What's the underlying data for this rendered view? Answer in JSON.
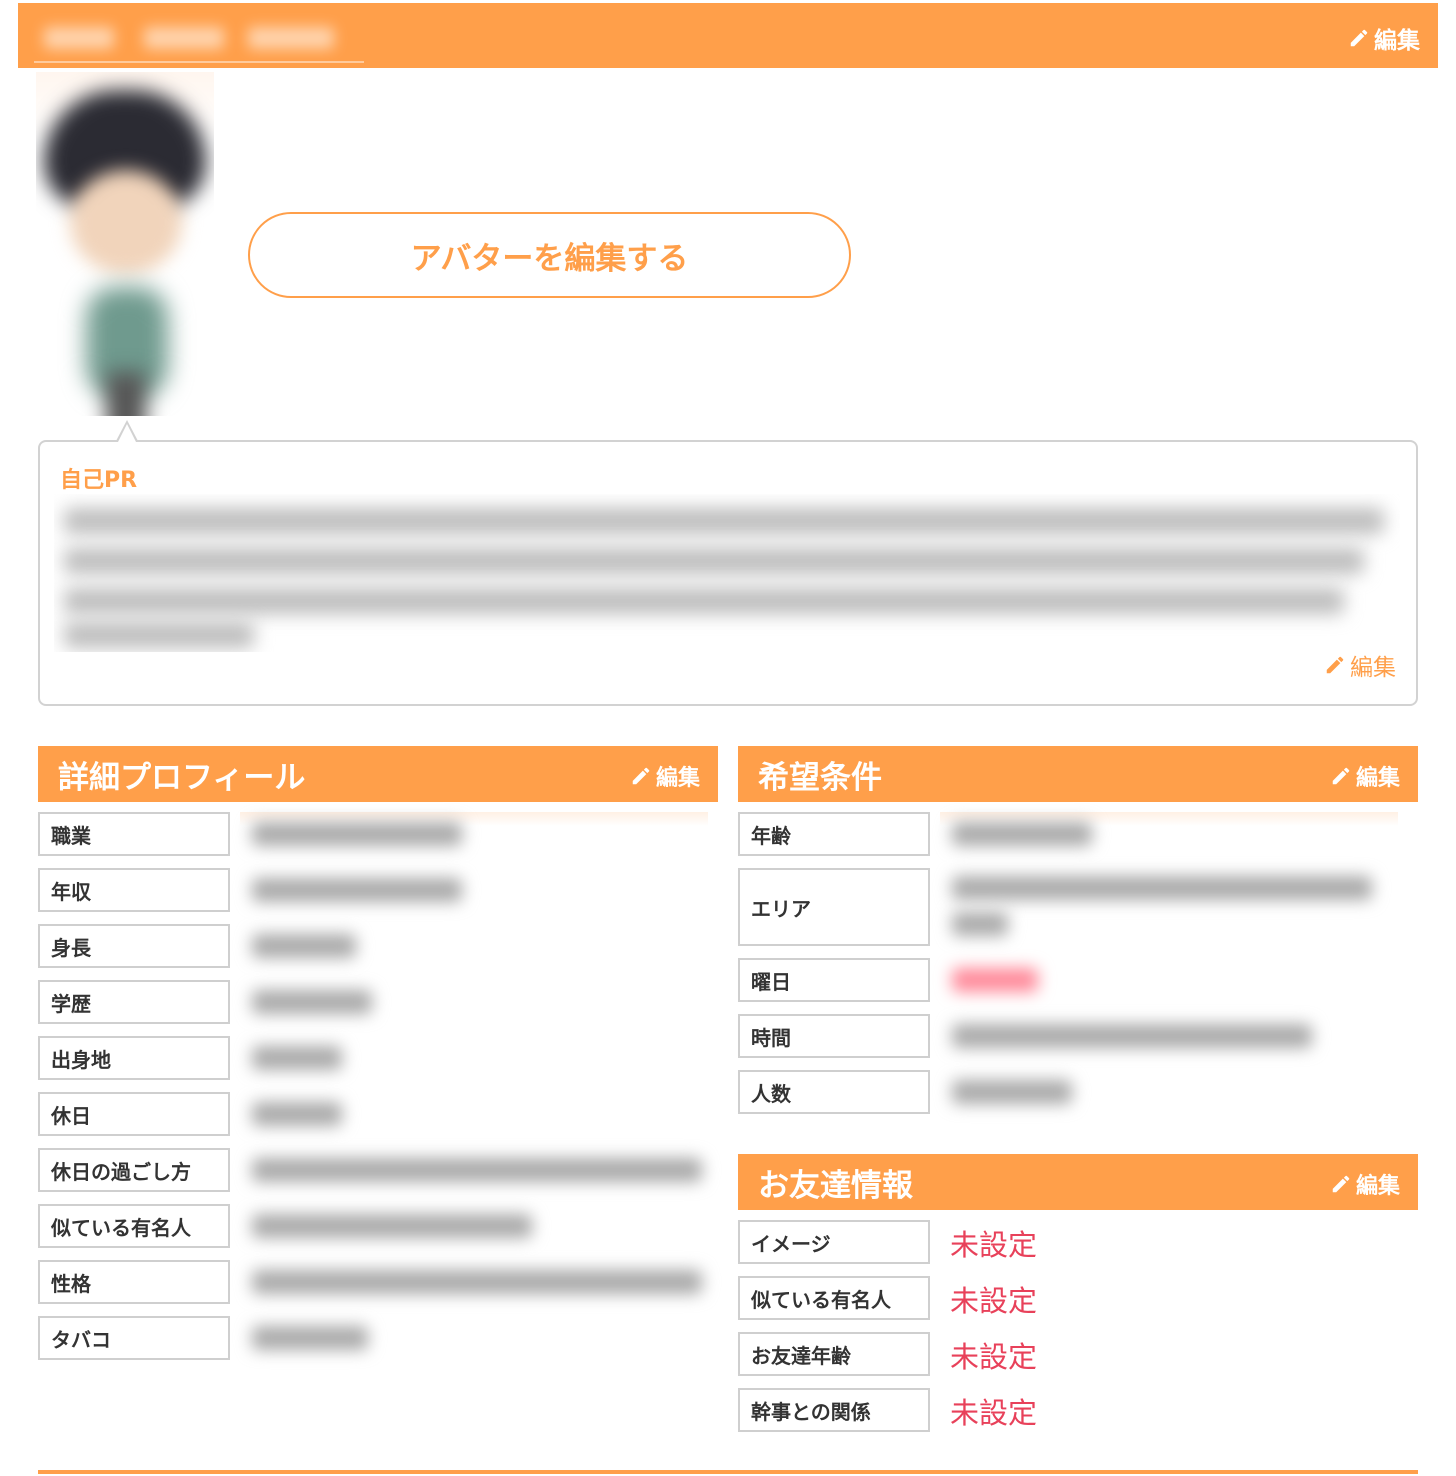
{
  "header": {
    "edit_label": "編集"
  },
  "avatar": {
    "edit_button_label": "アバターを編集する"
  },
  "pr": {
    "title": "自己PR",
    "edit_label": "編集"
  },
  "detail_profile": {
    "title": "詳細プロフィール",
    "edit_label": "編集",
    "rows": [
      "職業",
      "年収",
      "身長",
      "学歴",
      "出身地",
      "休日",
      "休日の過ごし方",
      "似ている有名人",
      "性格",
      "タバコ"
    ]
  },
  "preferences": {
    "title": "希望条件",
    "edit_label": "編集",
    "rows": [
      "年齢",
      "エリア",
      "曜日",
      "時間",
      "人数"
    ]
  },
  "friend_info": {
    "title": "お友達情報",
    "edit_label": "編集",
    "rows": [
      {
        "label": "イメージ",
        "value": "未設定"
      },
      {
        "label": "似ている有名人",
        "value": "未設定"
      },
      {
        "label": "お友達年齢",
        "value": "未設定"
      },
      {
        "label": "幹事との関係",
        "value": "未設定"
      }
    ]
  },
  "colors": {
    "accent": "#ff9f4a",
    "unset": "#e8415a",
    "border": "#cfcfcf"
  },
  "icons": {
    "edit": "pencil-icon"
  }
}
